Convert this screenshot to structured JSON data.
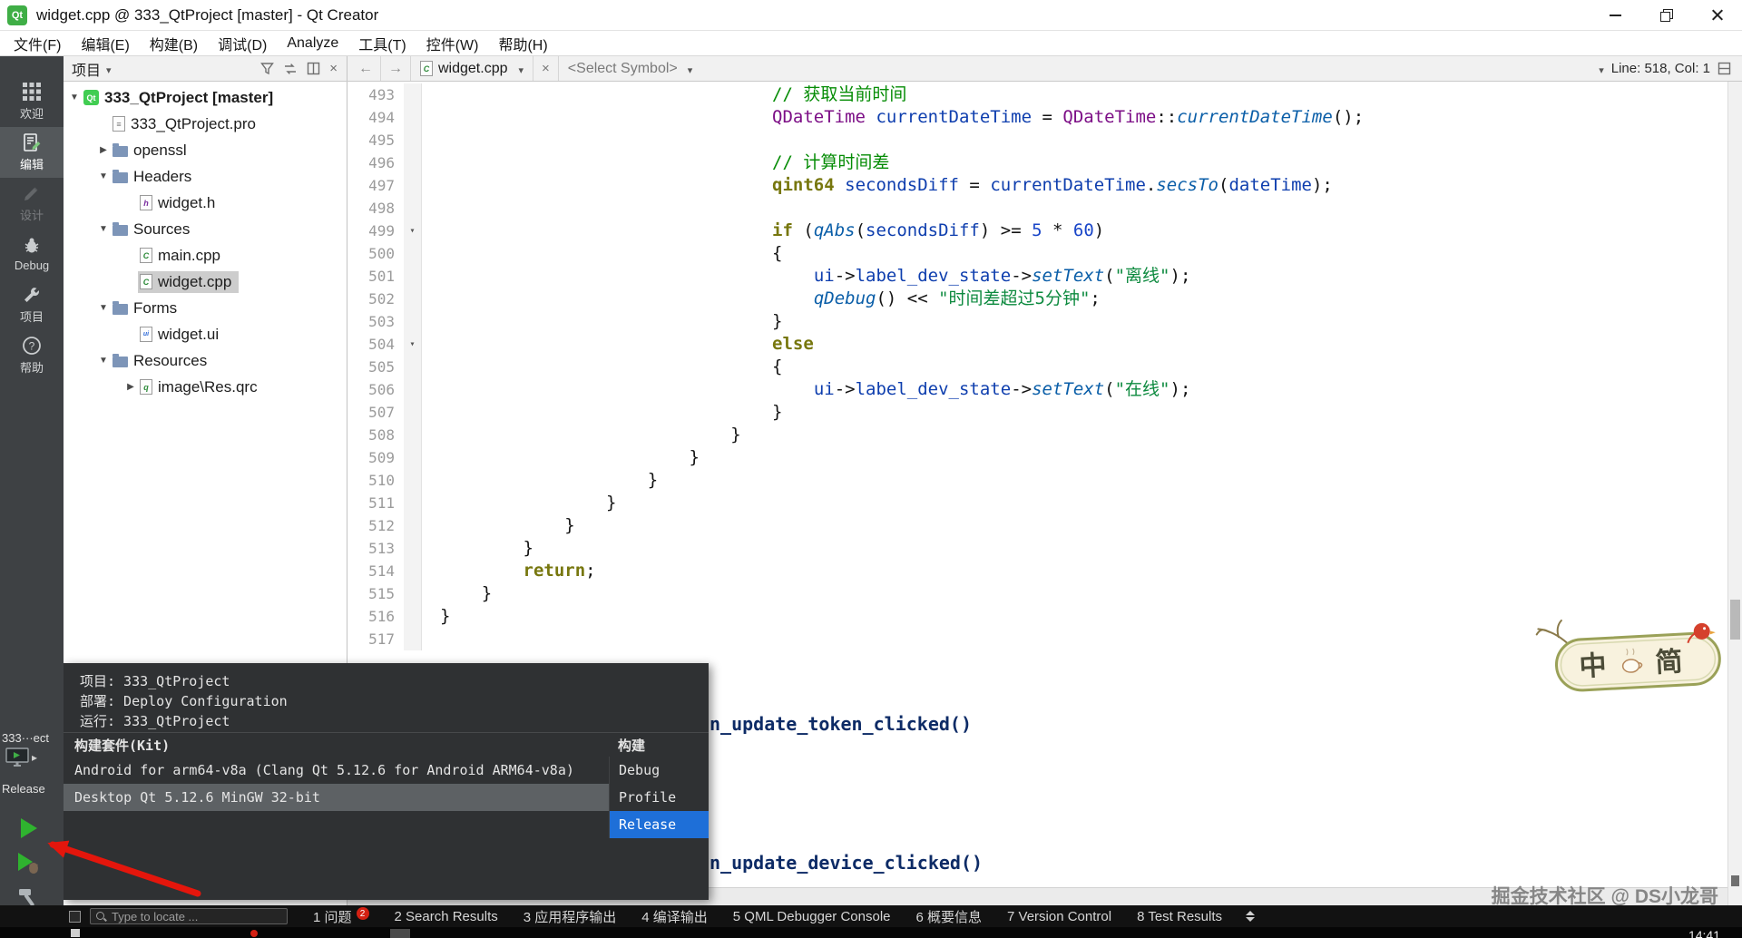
{
  "icons": {
    "qt_logo": "Qt",
    "expanded": "▼",
    "collapsed": "▶",
    "caret": "▾",
    "close": "×",
    "back": "←",
    "forward": "→",
    "help_glyph": "?",
    "popup_arrow": "▸",
    "file_letters": {
      "file-h": "h",
      "file-cpp": "C",
      "file-ui": "ui",
      "file-qrc": "q",
      "pro": "≡"
    }
  },
  "titlebar": {
    "title": "widget.cpp @ 333_QtProject [master] - Qt Creator"
  },
  "menu": {
    "items": [
      "文件(F)",
      "编辑(E)",
      "构建(B)",
      "调试(D)",
      "Analyze",
      "工具(T)",
      "控件(W)",
      "帮助(H)"
    ]
  },
  "modes": {
    "items": [
      {
        "label": "欢迎",
        "icon": "welcome"
      },
      {
        "label": "编辑",
        "icon": "edit",
        "active": true
      },
      {
        "label": "设计",
        "icon": "design",
        "disabled": true
      },
      {
        "label": "Debug",
        "icon": "debug"
      },
      {
        "label": "项目",
        "icon": "projects"
      },
      {
        "label": "帮助",
        "icon": "help"
      }
    ],
    "project_label": "333···ect",
    "config_label": "Release"
  },
  "project_panel": {
    "header": "项目",
    "tree": [
      {
        "depth": 0,
        "exp": "expanded",
        "icon": "qt",
        "label": "333_QtProject [master]",
        "bold": true
      },
      {
        "depth": 1,
        "icon": "pro",
        "label": "333_QtProject.pro"
      },
      {
        "depth": 1,
        "exp": "collapsed",
        "icon": "folder",
        "label": "openssl"
      },
      {
        "depth": 1,
        "exp": "expanded",
        "icon": "folder",
        "label": "Headers"
      },
      {
        "depth": 2,
        "icon": "file-h",
        "label": "widget.h"
      },
      {
        "depth": 1,
        "exp": "expanded",
        "icon": "folder",
        "label": "Sources"
      },
      {
        "depth": 2,
        "icon": "file-cpp",
        "label": "main.cpp"
      },
      {
        "depth": 2,
        "icon": "file-cpp",
        "label": "widget.cpp",
        "selected": true
      },
      {
        "depth": 1,
        "exp": "expanded",
        "icon": "folder",
        "label": "Forms"
      },
      {
        "depth": 2,
        "icon": "file-ui",
        "label": "widget.ui"
      },
      {
        "depth": 1,
        "exp": "expanded",
        "icon": "folder",
        "label": "Resources"
      },
      {
        "depth": 2,
        "exp": "collapsed",
        "icon": "file-qrc",
        "label": "image\\Res.qrc"
      }
    ]
  },
  "editor_bar": {
    "file": "widget.cpp",
    "symbol": "<Select Symbol>",
    "cursor": "Line: 518, Col: 1"
  },
  "editor": {
    "lines": [
      {
        "n": 493,
        "i": 32,
        "tk": [
          [
            "// 获取当前时间",
            "cm"
          ]
        ]
      },
      {
        "n": 494,
        "i": 32,
        "tk": [
          [
            "QDateTime",
            "ty"
          ],
          [
            " "
          ],
          [
            "currentDateTime",
            "va"
          ],
          [
            " = "
          ],
          [
            "QDateTime",
            "ty"
          ],
          [
            "::"
          ],
          [
            "currentDateTime",
            "fn"
          ],
          [
            "();"
          ]
        ]
      },
      {
        "n": 495,
        "i": 0,
        "tk": []
      },
      {
        "n": 496,
        "i": 32,
        "tk": [
          [
            "// 计算时间差",
            "cm"
          ]
        ]
      },
      {
        "n": 497,
        "i": 32,
        "tk": [
          [
            "qint64",
            "kw"
          ],
          [
            " "
          ],
          [
            "secondsDiff",
            "va"
          ],
          [
            " = "
          ],
          [
            "currentDateTime",
            "va"
          ],
          [
            "."
          ],
          [
            "secsTo",
            "fn"
          ],
          [
            "("
          ],
          [
            "dateTime",
            "va"
          ],
          [
            ");"
          ]
        ]
      },
      {
        "n": 498,
        "i": 0,
        "tk": []
      },
      {
        "n": 499,
        "i": 32,
        "fold": true,
        "tk": [
          [
            "if",
            "kw"
          ],
          [
            " ("
          ],
          [
            "qAbs",
            "fn"
          ],
          [
            "("
          ],
          [
            "secondsDiff",
            "va"
          ],
          [
            ") >= "
          ],
          [
            "5",
            "nu"
          ],
          [
            " * "
          ],
          [
            "60",
            "nu"
          ],
          [
            ")"
          ]
        ]
      },
      {
        "n": 500,
        "i": 32,
        "tk": [
          [
            "{"
          ]
        ]
      },
      {
        "n": 501,
        "i": 36,
        "tk": [
          [
            "ui",
            "va"
          ],
          [
            "->"
          ],
          [
            "label_dev_state",
            "va"
          ],
          [
            "->"
          ],
          [
            "setText",
            "fn"
          ],
          [
            "("
          ],
          [
            "\"离线\"",
            "st"
          ],
          [
            ");"
          ]
        ]
      },
      {
        "n": 502,
        "i": 36,
        "tk": [
          [
            "qDebug",
            "fn"
          ],
          [
            "() << "
          ],
          [
            "\"时间差超过5分钟\"",
            "st"
          ],
          [
            ";"
          ]
        ]
      },
      {
        "n": 503,
        "i": 32,
        "tk": [
          [
            "}"
          ]
        ]
      },
      {
        "n": 504,
        "i": 32,
        "fold": true,
        "tk": [
          [
            "else",
            "kw"
          ]
        ]
      },
      {
        "n": 505,
        "i": 32,
        "tk": [
          [
            "{"
          ]
        ]
      },
      {
        "n": 506,
        "i": 36,
        "tk": [
          [
            "ui",
            "va"
          ],
          [
            "->"
          ],
          [
            "label_dev_state",
            "va"
          ],
          [
            "->"
          ],
          [
            "setText",
            "fn"
          ],
          [
            "("
          ],
          [
            "\"在线\"",
            "st"
          ],
          [
            ");"
          ]
        ]
      },
      {
        "n": 507,
        "i": 32,
        "tk": [
          [
            "}"
          ]
        ]
      },
      {
        "n": 508,
        "i": 28,
        "tk": [
          [
            "}"
          ]
        ]
      },
      {
        "n": 509,
        "i": 24,
        "tk": [
          [
            "}"
          ]
        ]
      },
      {
        "n": 510,
        "i": 20,
        "tk": [
          [
            "}"
          ]
        ]
      },
      {
        "n": 511,
        "i": 16,
        "tk": [
          [
            "}"
          ]
        ]
      },
      {
        "n": 512,
        "i": 12,
        "tk": [
          [
            "}"
          ]
        ]
      },
      {
        "n": 513,
        "i": 8,
        "tk": [
          [
            "}"
          ]
        ]
      },
      {
        "n": 514,
        "i": 8,
        "tk": [
          [
            "return",
            "kw"
          ],
          [
            ";"
          ]
        ]
      },
      {
        "n": 515,
        "i": 4,
        "tk": [
          [
            "}"
          ]
        ]
      },
      {
        "n": 516,
        "i": 0,
        "tk": [
          [
            "}"
          ]
        ]
      },
      {
        "n": 517,
        "i": 0,
        "tk": []
      }
    ],
    "partials": [
      "n_update_token_clicked()",
      "n_update_device_clicked()"
    ]
  },
  "kit_popup": {
    "info": [
      {
        "label": "项目:",
        "value": "333_QtProject"
      },
      {
        "label": "部署:",
        "value": "Deploy Configuration"
      },
      {
        "label": "运行:",
        "value": "333_QtProject"
      }
    ],
    "kit_header": "构建套件(Kit)",
    "build_header": "构建",
    "kits": [
      {
        "label": "Android for arm64-v8a (Clang Qt 5.12.6 for Android ARM64-v8a)"
      },
      {
        "label": "Desktop Qt 5.12.6 MinGW 32-bit",
        "highlighted": true
      }
    ],
    "builds": [
      {
        "label": "Debug"
      },
      {
        "label": "Profile"
      },
      {
        "label": "Release",
        "selected": true
      }
    ]
  },
  "statusbar": {
    "locator": "Type to locate ...",
    "panes": [
      {
        "label": "1 问题",
        "badge": "2"
      },
      {
        "label": "2 Search Results"
      },
      {
        "label": "3 应用程序输出"
      },
      {
        "label": "4 编译输出"
      },
      {
        "label": "5 QML Debugger Console"
      },
      {
        "label": "6 概要信息"
      },
      {
        "label": "7 Version Control"
      },
      {
        "label": "8 Test Results"
      }
    ]
  },
  "watermark": "掘金技术社区 @ DS小龙哥",
  "taskbar": {
    "clock": "14:41"
  },
  "sticker": {
    "left": "中",
    "right": "简"
  }
}
